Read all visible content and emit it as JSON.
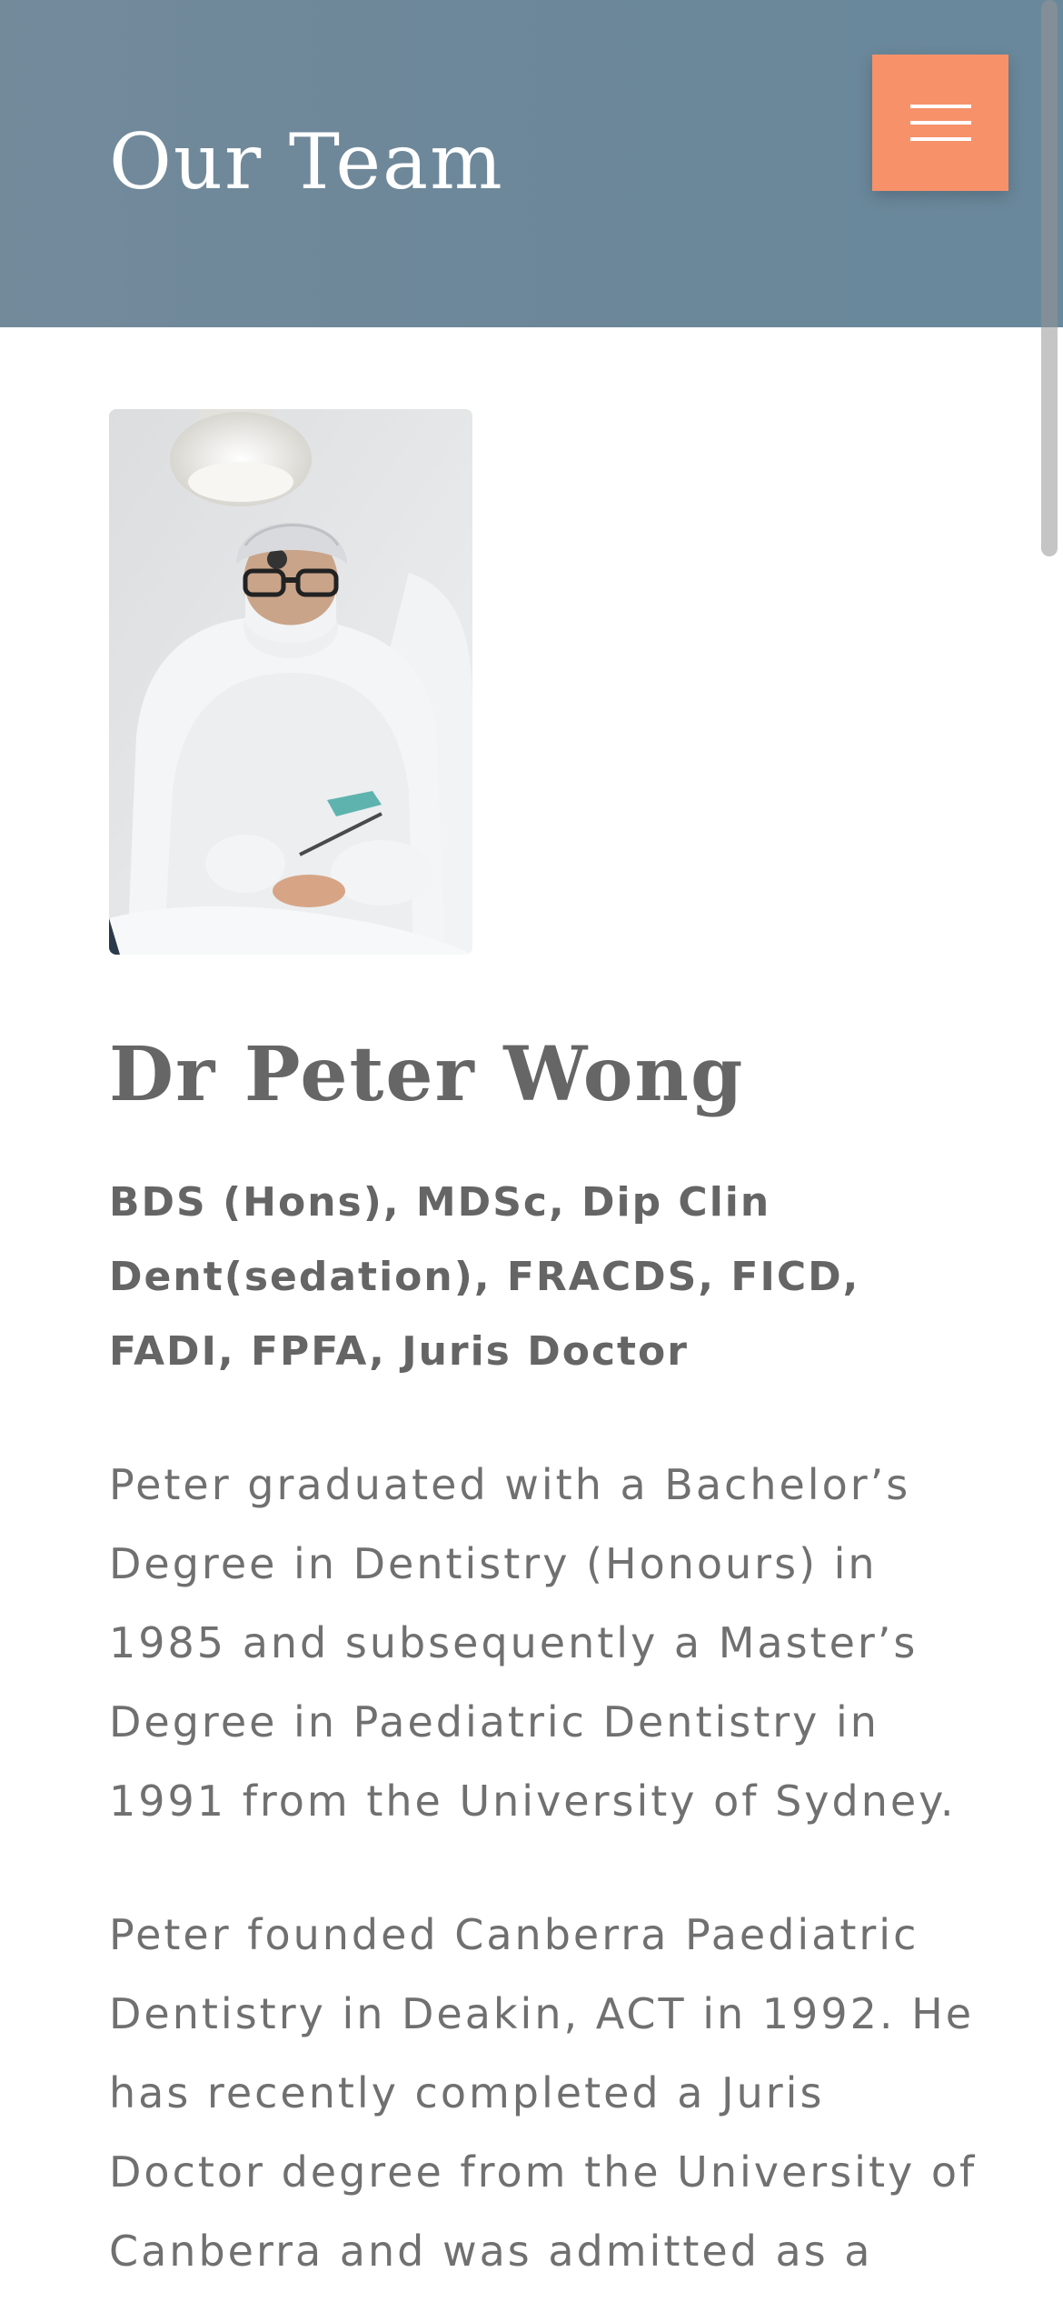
{
  "header": {
    "title": "Our Team",
    "menu_icon": "hamburger-icon",
    "background_color": "#6b8799",
    "menu_button_color": "#f6916a"
  },
  "member": {
    "photo_description_icon": "dentist-photo",
    "name": "Dr Peter Wong",
    "credentials": "BDS (Hons), MDSc, Dip Clin Dent(sedation), FRACDS, FICD, FADI, FPFA, Juris Doctor",
    "bio": [
      "Peter graduated with a Bachelor’s Degree in Dentistry (Honours) in 1985 and subsequently a Master’s Degree in Paediatric Dentistry in 1991 from the University of Sydney.",
      "Peter founded Canberra Paediatric Dentistry in Deakin, ACT in 1992. He has recently completed a Juris Doctor degree from the University of Canberra and was admitted as a"
    ]
  }
}
